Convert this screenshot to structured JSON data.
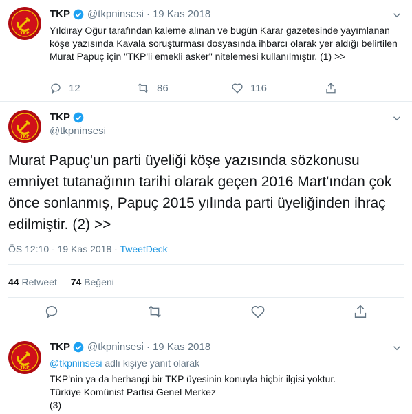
{
  "tweets": [
    {
      "name": "TKP",
      "handle": "@tkpninsesi",
      "date": "19 Kas 2018",
      "text": "Yıldıray Oğur tarafından kaleme alınan ve bugün Karar gazetesinde yayımlanan köşe yazısında Kavala soruşturması dosyasında ihbarcı olarak yer aldığı belirtilen Murat Papuç için \"TKP'li emekli asker\" nitelemesi kullanılmıştır. (1) >>",
      "counts": {
        "replies": "12",
        "retweets": "86",
        "likes": "116"
      }
    },
    {
      "name": "TKP",
      "handle": "@tkpninsesi",
      "text": "Murat Papuç'un parti üyeliği köşe yazısında sözkonusu emniyet tutanağının tarihi olarak geçen 2016 Mart'ından çok önce sonlanmış, Papuç 2015 yılında parti üyeliğinden ihraç edilmiştir. (2) >>",
      "time": "ÖS 12:10",
      "date": "19 Kas 2018",
      "source": "TweetDeck",
      "stats": {
        "retweets_count": "44",
        "retweets_label": "Retweet",
        "likes_count": "74",
        "likes_label": "Beğeni"
      }
    },
    {
      "name": "TKP",
      "handle": "@tkpninsesi",
      "date": "19 Kas 2018",
      "reply_to_handle": "@tkpninsesi",
      "reply_to_suffix": "adlı kişiye yanıt olarak",
      "lines": [
        "TKP'nin ya da herhangi bir TKP üyesinin konuyla hiçbir ilgisi yoktur.",
        "Türkiye Komünist Partisi Genel Merkez",
        "(3)"
      ]
    }
  ],
  "colors": {
    "accent": "#1b95e0",
    "secondary": "#657786",
    "avatar": "#d0101a"
  },
  "icons": [
    "verified-icon",
    "chevron-down-icon",
    "reply-icon",
    "retweet-icon",
    "like-icon",
    "share-icon",
    "avatar-logo"
  ]
}
